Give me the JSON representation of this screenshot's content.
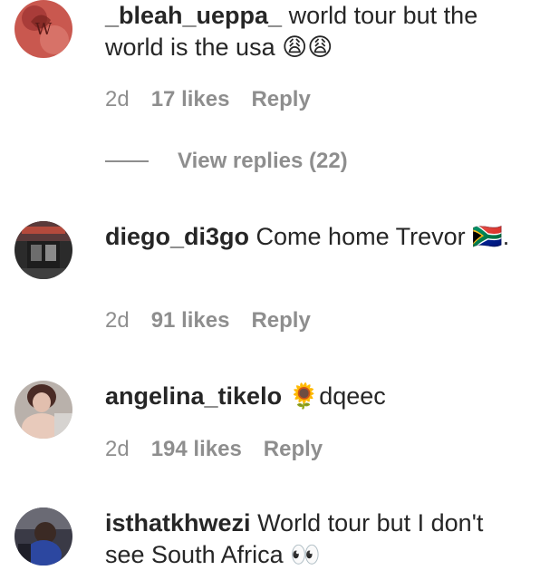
{
  "comments": [
    {
      "username": "_bleah_ueppa_",
      "text": "world tour but the world is the usa 😩😩",
      "time": "2d",
      "likes": "17 likes",
      "reply": "Reply",
      "view_replies": "View replies (22)"
    },
    {
      "username": "diego_di3go",
      "text": "Come home Trevor 🇿🇦.",
      "time": "2d",
      "likes": "91 likes",
      "reply": "Reply"
    },
    {
      "username": "angelina_tikelo",
      "text": "🌻dqeec",
      "time": "2d",
      "likes": "194 likes",
      "reply": "Reply"
    },
    {
      "username": "isthatkhwezi",
      "text": "World tour but I don't see South Africa 👀"
    }
  ],
  "colors": {
    "text": "#262626",
    "muted": "#8e8e8e",
    "background": "#ffffff"
  }
}
